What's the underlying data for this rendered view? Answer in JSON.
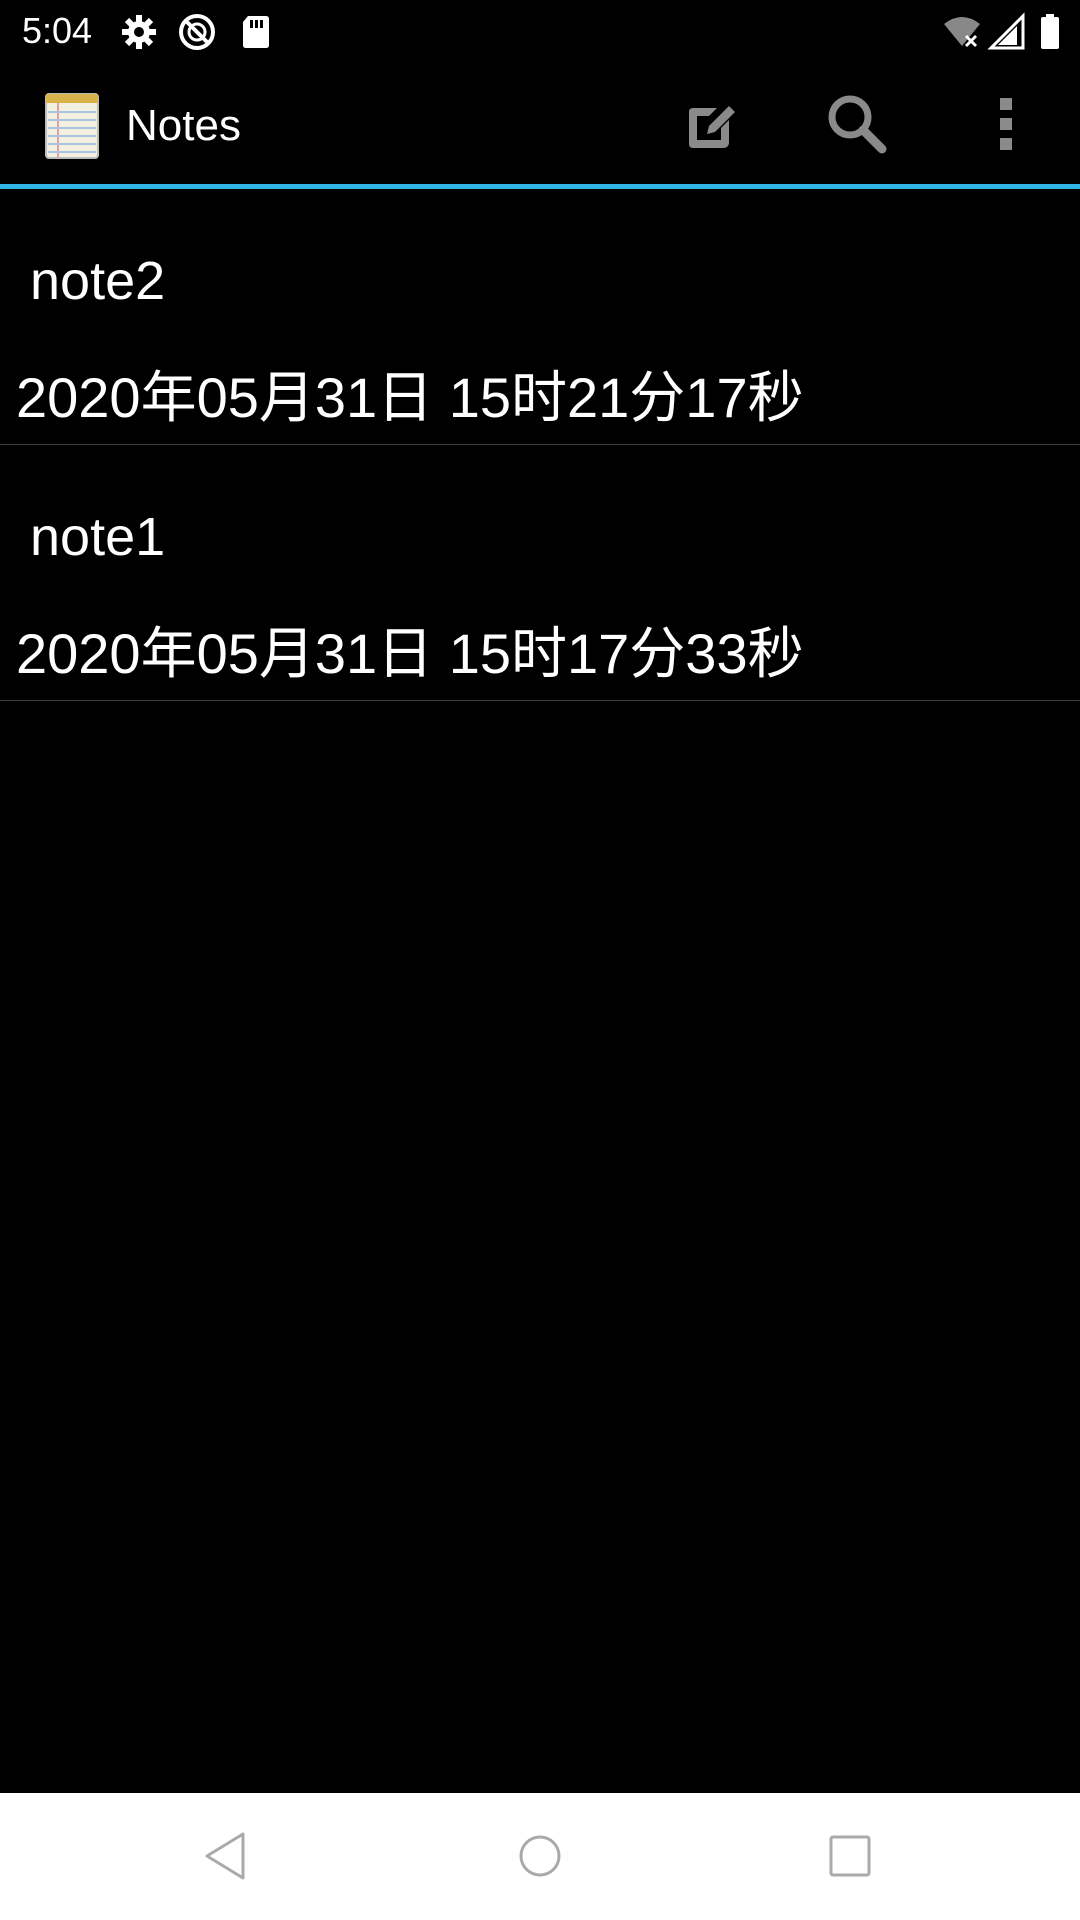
{
  "status_bar": {
    "time": "5:04",
    "icons": [
      "gear-icon",
      "do-not-disturb-icon",
      "sd-card-icon",
      "wifi-off-icon",
      "cell-signal-icon",
      "battery-icon"
    ]
  },
  "action_bar": {
    "title": "Notes",
    "app_icon": "notepad-icon",
    "actions": [
      "new-note-icon",
      "search-icon",
      "overflow-menu-icon"
    ],
    "accent_color": "#33b5e5"
  },
  "notes": [
    {
      "title": "note2",
      "date": "2020年05月31日 15时21分17秒"
    },
    {
      "title": "note1",
      "date": "2020年05月31日 15时17分33秒"
    }
  ],
  "nav_bar": {
    "buttons": [
      "back-icon",
      "home-icon",
      "recents-icon"
    ]
  }
}
